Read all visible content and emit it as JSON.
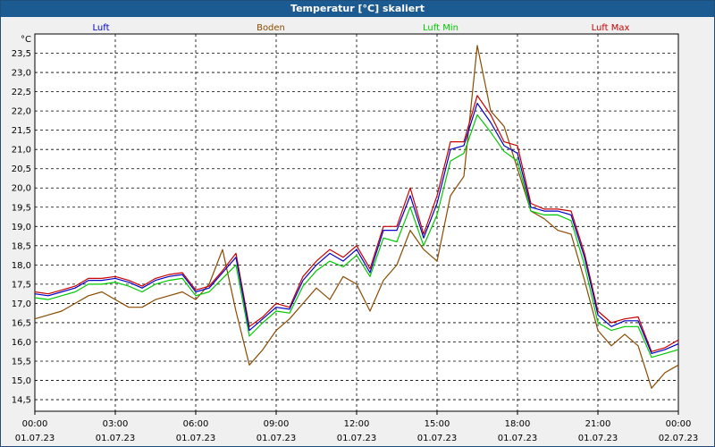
{
  "window": {
    "title": "Temperatur [°C] skaliert"
  },
  "chart_data": {
    "type": "line",
    "title": "Temperatur [°C] skaliert",
    "ylabel": "°C",
    "xlabel": "",
    "ylim": [
      14.2,
      24.0
    ],
    "yticks": [
      14.5,
      15.0,
      15.5,
      16.0,
      16.5,
      17.0,
      17.5,
      18.0,
      18.5,
      19.0,
      19.5,
      20.0,
      20.5,
      21.0,
      21.5,
      22.0,
      22.5,
      23.0,
      23.5
    ],
    "ytick_labels": [
      "14,5",
      "15,0",
      "15,5",
      "16,0",
      "16,5",
      "17,0",
      "17,5",
      "18,0",
      "18,5",
      "19,0",
      "19,5",
      "20,0",
      "20,5",
      "21,0",
      "21,5",
      "22,0",
      "22,5",
      "23,0",
      "23,5"
    ],
    "xlim": [
      0,
      24
    ],
    "xticks": [
      0,
      3,
      6,
      9,
      12,
      15,
      18,
      21,
      24
    ],
    "xtick_labels": [
      {
        "time": "00:00",
        "date": "01.07.23"
      },
      {
        "time": "03:00",
        "date": "01.07.23"
      },
      {
        "time": "06:00",
        "date": "01.07.23"
      },
      {
        "time": "09:00",
        "date": "01.07.23"
      },
      {
        "time": "12:00",
        "date": "01.07.23"
      },
      {
        "time": "15:00",
        "date": "01.07.23"
      },
      {
        "time": "18:00",
        "date": "01.07.23"
      },
      {
        "time": "21:00",
        "date": "01.07.23"
      },
      {
        "time": "00:00",
        "date": "02.07.23"
      }
    ],
    "grid": true,
    "legend": "top",
    "x": [
      0,
      0.5,
      1,
      1.5,
      2,
      2.5,
      3,
      3.5,
      4,
      4.5,
      5,
      5.5,
      6,
      6.5,
      7,
      7.5,
      8,
      8.5,
      9,
      9.5,
      10,
      10.5,
      11,
      11.5,
      12,
      12.5,
      13,
      13.5,
      14,
      14.5,
      15,
      15.5,
      16,
      16.5,
      17,
      17.5,
      18,
      18.5,
      19,
      19.5,
      20,
      20.5,
      21,
      21.5,
      22,
      22.5,
      23,
      23.5,
      24
    ],
    "series": [
      {
        "name": "Luft",
        "color": "#0000c8",
        "values": [
          17.25,
          17.2,
          17.3,
          17.4,
          17.6,
          17.6,
          17.65,
          17.55,
          17.4,
          17.6,
          17.7,
          17.75,
          17.3,
          17.4,
          17.8,
          18.2,
          16.3,
          16.6,
          16.9,
          16.85,
          17.6,
          18.0,
          18.3,
          18.1,
          18.4,
          17.8,
          18.9,
          18.9,
          19.8,
          18.7,
          19.6,
          21.0,
          21.1,
          22.2,
          21.7,
          21.1,
          20.9,
          19.5,
          19.4,
          19.4,
          19.3,
          18.2,
          16.7,
          16.4,
          16.55,
          16.55,
          15.7,
          15.8,
          15.95
        ]
      },
      {
        "name": "Boden",
        "color": "#8a4b00",
        "values": [
          16.6,
          16.7,
          16.8,
          17.0,
          17.2,
          17.3,
          17.1,
          16.9,
          16.9,
          17.1,
          17.2,
          17.3,
          17.1,
          17.5,
          18.4,
          16.8,
          15.4,
          15.8,
          16.3,
          16.6,
          17.0,
          17.4,
          17.1,
          17.7,
          17.5,
          16.8,
          17.6,
          18.0,
          18.9,
          18.4,
          18.1,
          19.8,
          20.3,
          23.7,
          22.0,
          21.6,
          20.5,
          19.4,
          19.2,
          18.9,
          18.8,
          17.6,
          16.3,
          15.9,
          16.2,
          15.9,
          14.8,
          15.2,
          15.4
        ]
      },
      {
        "name": "Luft Min",
        "color": "#00c800",
        "values": [
          17.15,
          17.1,
          17.2,
          17.3,
          17.5,
          17.5,
          17.55,
          17.45,
          17.3,
          17.5,
          17.6,
          17.65,
          17.2,
          17.3,
          17.65,
          18.0,
          16.15,
          16.5,
          16.8,
          16.75,
          17.45,
          17.85,
          18.1,
          17.95,
          18.25,
          17.7,
          18.7,
          18.6,
          19.5,
          18.5,
          19.3,
          20.7,
          20.9,
          21.9,
          21.45,
          20.95,
          20.7,
          19.4,
          19.3,
          19.3,
          19.15,
          18.0,
          16.5,
          16.3,
          16.4,
          16.4,
          15.6,
          15.7,
          15.8
        ]
      },
      {
        "name": "Luft Max",
        "color": "#c80000",
        "values": [
          17.3,
          17.25,
          17.35,
          17.45,
          17.65,
          17.65,
          17.7,
          17.6,
          17.45,
          17.65,
          17.75,
          17.8,
          17.35,
          17.45,
          17.85,
          18.3,
          16.4,
          16.65,
          17.0,
          16.9,
          17.7,
          18.1,
          18.4,
          18.2,
          18.5,
          17.9,
          19.0,
          19.0,
          20.0,
          18.8,
          19.8,
          21.2,
          21.2,
          22.4,
          21.9,
          21.2,
          21.1,
          19.6,
          19.45,
          19.45,
          19.4,
          18.3,
          16.8,
          16.5,
          16.6,
          16.65,
          15.75,
          15.85,
          16.05
        ]
      }
    ]
  }
}
